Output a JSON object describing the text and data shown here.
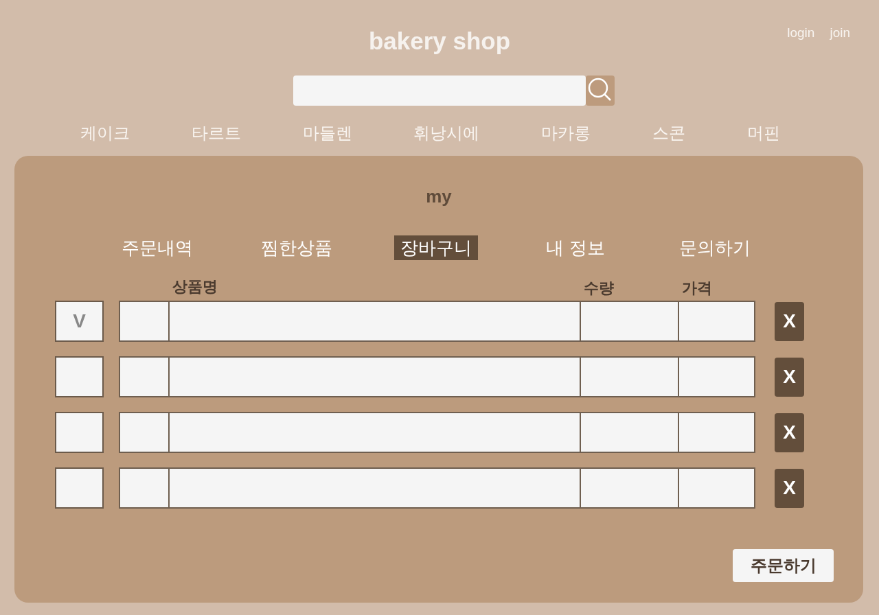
{
  "header": {
    "title": "bakery shop",
    "links": [
      "login",
      "join"
    ]
  },
  "categories": [
    "케이크",
    "타르트",
    "마들렌",
    "휘낭시에",
    "마카롱",
    "스콘",
    "머핀"
  ],
  "mypage": {
    "title": "my",
    "tabs": [
      {
        "label": "주문내역",
        "selected": false
      },
      {
        "label": "찜한상품",
        "selected": false
      },
      {
        "label": "장바구니",
        "selected": true
      },
      {
        "label": "내 정보",
        "selected": false
      },
      {
        "label": "문의하기",
        "selected": false
      }
    ],
    "cart": {
      "columns": [
        "상품명",
        "수량",
        "가격"
      ],
      "check_mark": "V",
      "rows": [
        {
          "checked": true,
          "delete": "X"
        },
        {
          "checked": false,
          "delete": "X"
        },
        {
          "checked": false,
          "delete": "X"
        },
        {
          "checked": false,
          "delete": "X"
        }
      ]
    },
    "order_button": "주문하기"
  }
}
